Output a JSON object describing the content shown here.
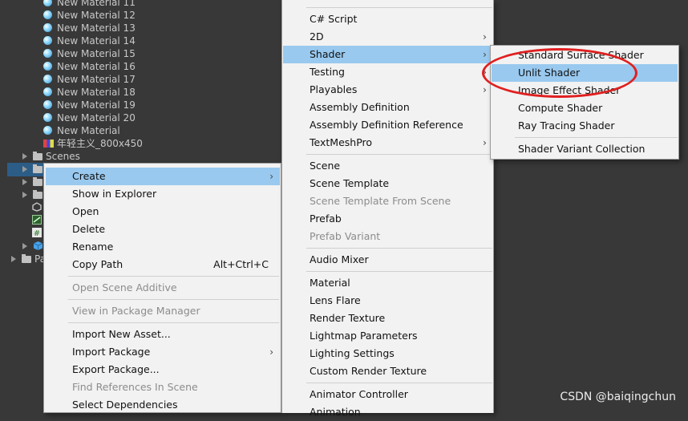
{
  "project": {
    "materials": [
      "New Material 11",
      "New Material 12",
      "New Material 13",
      "New Material 14",
      "New Material 15",
      "New Material 16",
      "New Material 17",
      "New Material 18",
      "New Material 19",
      "New Material 20",
      "New Material"
    ],
    "texture_label": "年轻主义_800x450",
    "scenes_folder": "Scenes",
    "packages_folder_partial": "Pa"
  },
  "context_menu": {
    "create": "Create",
    "show_in_explorer": "Show in Explorer",
    "open": "Open",
    "delete": "Delete",
    "rename": "Rename",
    "copy_path": "Copy Path",
    "copy_path_shortcut": "Alt+Ctrl+C",
    "open_scene_additive": "Open Scene Additive",
    "view_in_package_manager": "View in Package Manager",
    "import_new_asset": "Import New Asset...",
    "import_package": "Import Package",
    "export_package": "Export Package...",
    "find_references": "Find References In Scene",
    "select_dependencies": "Select Dependencies"
  },
  "create_menu": {
    "csharp_script": "C# Script",
    "two_d": "2D",
    "shader": "Shader",
    "testing": "Testing",
    "playables": "Playables",
    "assembly_definition": "Assembly Definition",
    "assembly_definition_reference": "Assembly Definition Reference",
    "textmeshpro": "TextMeshPro",
    "scene": "Scene",
    "scene_template": "Scene Template",
    "scene_template_from_scene": "Scene Template From Scene",
    "prefab": "Prefab",
    "prefab_variant": "Prefab Variant",
    "audio_mixer": "Audio Mixer",
    "material": "Material",
    "lens_flare": "Lens Flare",
    "render_texture": "Render Texture",
    "lightmap_parameters": "Lightmap Parameters",
    "lighting_settings": "Lighting Settings",
    "custom_render_texture": "Custom Render Texture",
    "animator_controller": "Animator Controller",
    "animation": "Animation"
  },
  "shader_menu": {
    "standard_surface_shader": "Standard Surface Shader",
    "unlit_shader": "Unlit Shader",
    "image_effect_shader": "Image Effect Shader",
    "compute_shader": "Compute Shader",
    "ray_tracing_shader": "Ray Tracing Shader",
    "shader_variant_collection": "Shader Variant Collection"
  },
  "submenu_arrow": "›",
  "watermark": "CSDN @baiqingchun",
  "colors": {
    "highlight": "#99c9ef",
    "panel_bg": "#383838",
    "menu_bg": "#f2f2f2",
    "annotation": "#e02020"
  }
}
